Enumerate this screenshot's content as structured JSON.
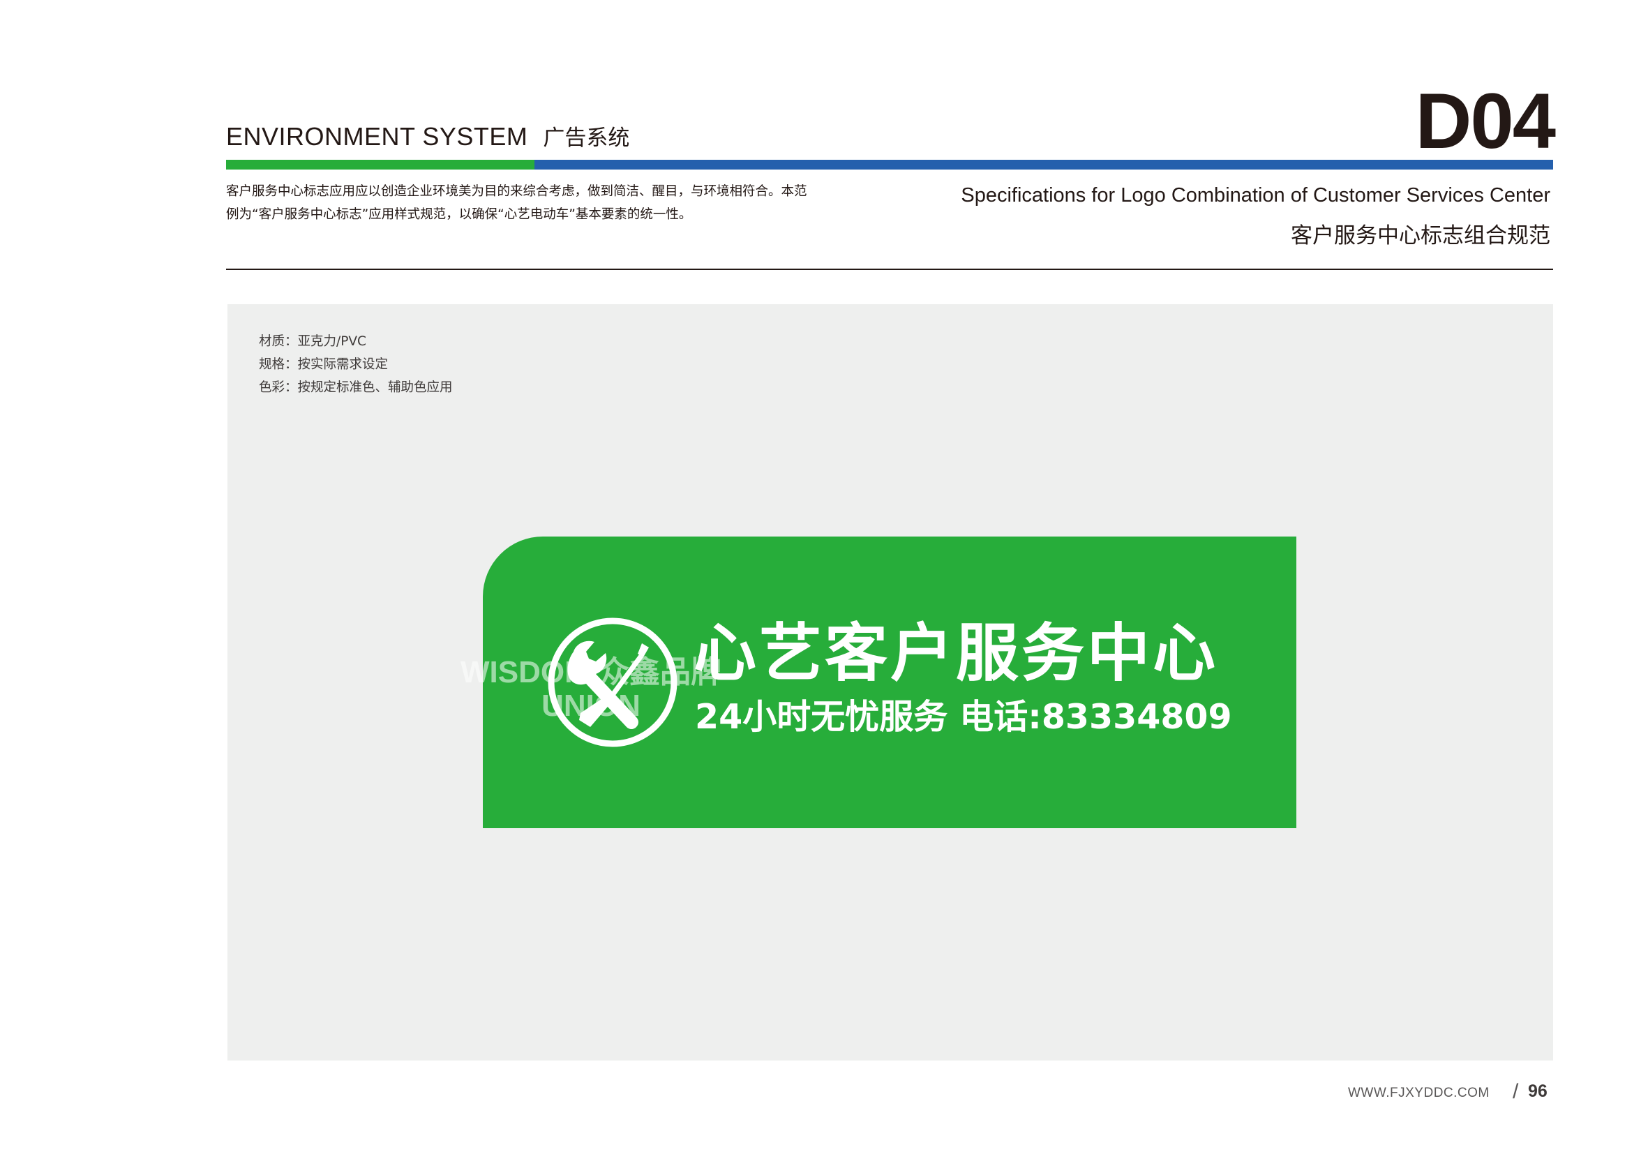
{
  "header": {
    "section_en": "ENVIRONMENT SYSTEM",
    "section_cn": "广告系统",
    "code": "D04",
    "intro_line1": "客户服务中心标志应用应以创造企业环境美为目的来综合考虑，做到简洁、醒目，与环境相符合。本范",
    "intro_line2": "例为“客户服务中心标志”应用样式规范，以确保“心艺电动车”基本要素的统一性。",
    "title_en": "Specifications for Logo Combination of Customer Services Center",
    "title_cn": "客户服务中心标志组合规范"
  },
  "specs": {
    "material": "材质：亚克力/PVC",
    "size": "规格：按实际需求设定",
    "color": "色彩：按规定标准色、辅助色应用"
  },
  "sign": {
    "title": "心艺客户服务中心",
    "subtitle": "24小时无忧服务  电话:83334809",
    "icon": "wrench-screwdriver-icon"
  },
  "watermark": {
    "line1": "WISDOM 众鑫品牌",
    "line2": "UNION"
  },
  "footer": {
    "website": "WWW.FJXYDDC.COM",
    "slash": "/",
    "page": "96"
  },
  "colors": {
    "brand_green": "#27ad3a",
    "brand_blue": "#2460ad",
    "panel_bg": "#eeefee",
    "text_dark": "#231815"
  }
}
